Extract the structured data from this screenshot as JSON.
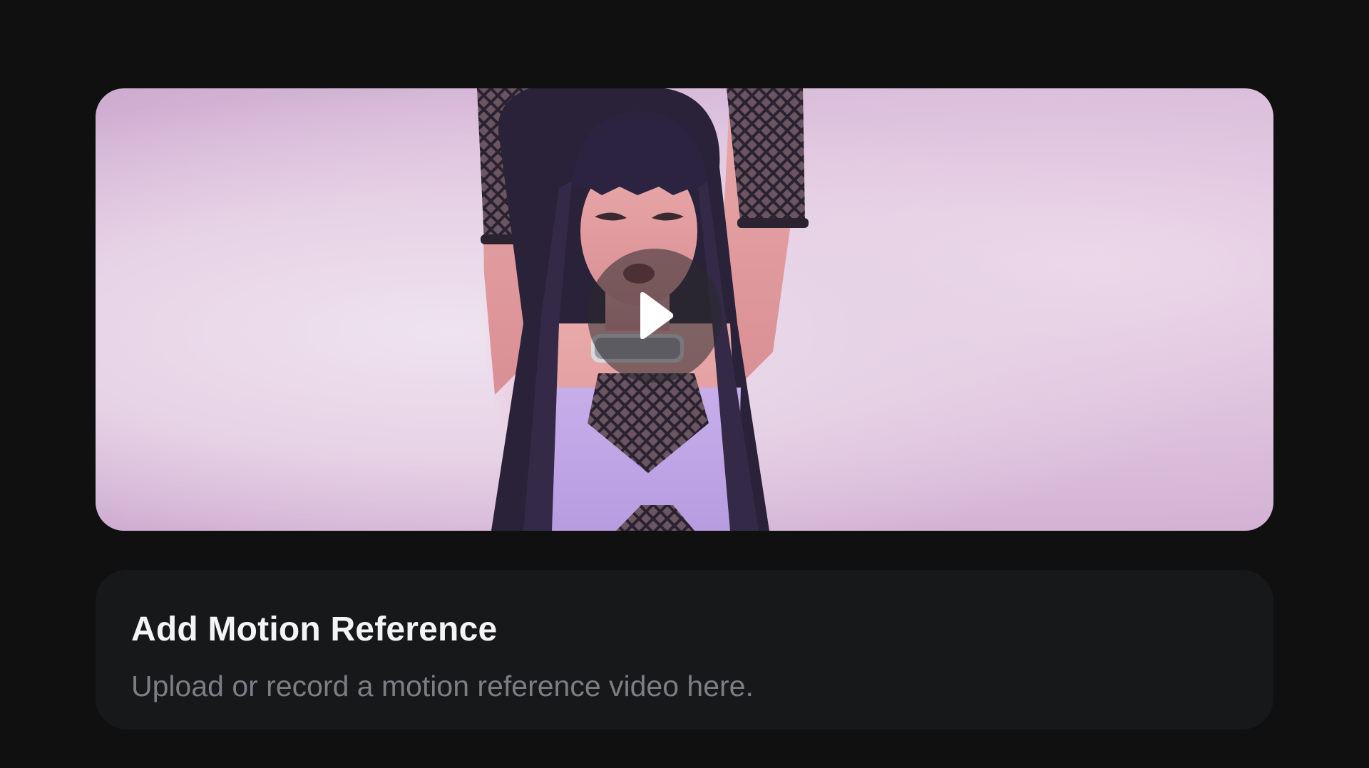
{
  "video": {
    "thumbnail_description_icon": "video-thumbnail",
    "play_icon": "play-icon"
  },
  "motion_reference": {
    "title": "Add Motion Reference",
    "subtitle": "Upload or record a motion reference video here."
  },
  "colors": {
    "background": "#101011",
    "card_background": "#17181a",
    "title_text": "#f4f4f5",
    "subtitle_text": "#7c7e84",
    "play_overlay": "#28282c"
  }
}
